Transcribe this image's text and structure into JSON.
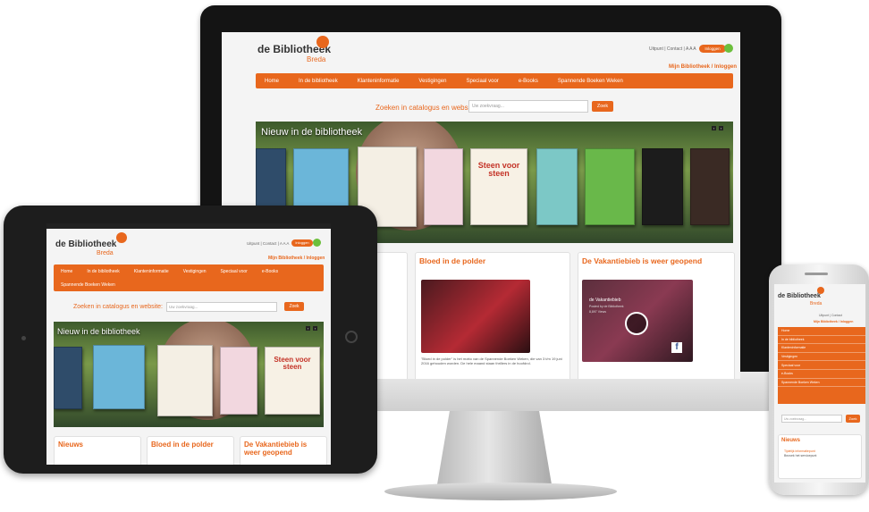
{
  "site": {
    "logo_main": "de Bibliotheek",
    "logo_sub": "Breda",
    "top_links": "Uitpunt | Contact | A A A",
    "top_links_phone": "Uitpunt | Contact",
    "login_btn": "Inloggen",
    "login_link": "Mijn Bibliotheek / Inloggen",
    "nav": [
      "Home",
      "In de bibliotheek",
      "Klanteninformatie",
      "Vestigingen",
      "Speciaal voor",
      "e-Books",
      "Spannende Boeken Weken"
    ],
    "search_label": "Zoeken in catalogus en website:",
    "search_placeholder": "Uw zoekvraag...",
    "search_button": "Zoek",
    "banner_title": "Nieuw in de bibliotheek",
    "panels": {
      "nieuws": "Nieuws",
      "bloed": "Bloed in de polder",
      "vakantie": "De Vakantiebieb is weer geopend"
    },
    "bloed_text": "\"Bloed in de polder\" is het motto van de Spannende Boeken Weken, die van 3 t/m 19 juni 2016 gehouden worden. De hele maand staan thrillers in de hoofdrol.",
    "video_caption": "de Vakantiebieb",
    "video_sub": "Posted by de Bibliotheek",
    "video_views": "8,897 Views",
    "book_title": "Steen voor steen",
    "nieuws_item": "Tijdelijk informatiepunt",
    "nieuws_sub": "Bezoek het servicepunt"
  }
}
